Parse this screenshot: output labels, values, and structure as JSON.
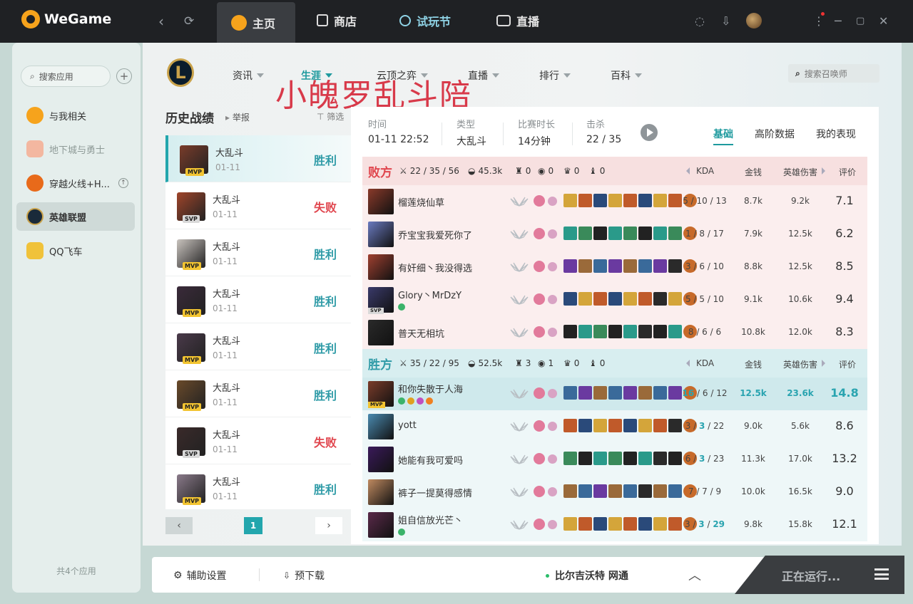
{
  "app": {
    "name": "WeGame"
  },
  "topnav": {
    "tabs": [
      {
        "label": "主页",
        "active": true
      },
      {
        "label": "商店"
      },
      {
        "label": "试玩节"
      },
      {
        "label": "直播"
      }
    ]
  },
  "sidebar": {
    "search_placeholder": "搜索应用",
    "items": [
      {
        "label": "与我相关",
        "color": "#f6a31c"
      },
      {
        "label": "地下城与勇士",
        "color": "#f3b7a0",
        "muted": true
      },
      {
        "label": "穿越火线+H...",
        "color": "#e86a1a"
      },
      {
        "label": "英雄联盟",
        "color": "#1a2a3a",
        "active": true
      },
      {
        "label": "QQ飞车",
        "color": "#f0c23a"
      }
    ],
    "footer": "共4个应用"
  },
  "game_menu": {
    "items": [
      "资讯",
      "生涯",
      "云顶之弈",
      "直播",
      "排行",
      "百科"
    ],
    "active": "生涯",
    "search_placeholder": "搜索召唤师",
    "watermark": "小魄罗乱斗陪"
  },
  "history": {
    "title": "历史战绩",
    "report": "举报",
    "filter": "筛选",
    "matches": [
      {
        "mode": "大乱斗",
        "date": "01-11",
        "result": "胜利",
        "badge": "MVP",
        "win": true,
        "color": "#7a3c2a"
      },
      {
        "mode": "大乱斗",
        "date": "01-11",
        "result": "失败",
        "badge": "SVP",
        "win": false,
        "color": "#a0452a"
      },
      {
        "mode": "大乱斗",
        "date": "01-11",
        "result": "胜利",
        "badge": "MVP",
        "win": true,
        "color": "#c9c3be"
      },
      {
        "mode": "大乱斗",
        "date": "01-11",
        "result": "胜利",
        "badge": "MVP",
        "win": true,
        "color": "#3a2a3a"
      },
      {
        "mode": "大乱斗",
        "date": "01-11",
        "result": "胜利",
        "badge": "MVP",
        "win": true,
        "color": "#4a3a4a"
      },
      {
        "mode": "大乱斗",
        "date": "01-11",
        "result": "胜利",
        "badge": "MVP",
        "win": true,
        "color": "#6a4a2a"
      },
      {
        "mode": "大乱斗",
        "date": "01-11",
        "result": "失败",
        "badge": "SVP",
        "win": false,
        "color": "#3a2a2a"
      },
      {
        "mode": "大乱斗",
        "date": "01-11",
        "result": "胜利",
        "badge": "MVP",
        "win": true,
        "color": "#8a7a8a"
      }
    ],
    "page": "1"
  },
  "match": {
    "labels": {
      "time": "时间",
      "type": "类型",
      "duration": "比赛时长",
      "kills": "击杀"
    },
    "time": "01-11 22:52",
    "type": "大乱斗",
    "duration": "14分钟",
    "kills": "22 / 35",
    "tabs": [
      "基础",
      "高阶数据",
      "我的表现"
    ],
    "columns": {
      "kda": "KDA",
      "gold": "金钱",
      "damage": "英雄伤害",
      "score": "评价"
    }
  },
  "teams": [
    {
      "name": "败方",
      "win": false,
      "kda": "22 / 35 / 56",
      "gold": "45.3k",
      "towers": "0",
      "inhib": "0",
      "baron": "0",
      "dragon": "0",
      "players": [
        {
          "name": "榴莲烧仙草",
          "kda": [
            "5",
            "10",
            "13"
          ],
          "gold": "8.7k",
          "damage": "9.2k",
          "score": "7.1",
          "color": "#8a3a2a",
          "badge": ""
        },
        {
          "name": "乔宝宝我爱死你了",
          "kda": [
            "1",
            "8",
            "17"
          ],
          "gold": "7.9k",
          "damage": "12.5k",
          "score": "6.2",
          "color": "#6a7ac0",
          "badge": ""
        },
        {
          "name": "有奸细丶我没得选",
          "kda": [
            "3",
            "6",
            "10"
          ],
          "gold": "8.8k",
          "damage": "12.5k",
          "score": "8.5",
          "color": "#a04030",
          "badge": ""
        },
        {
          "name": "Glory丶MrDzY",
          "kda": [
            "5",
            "5",
            "10"
          ],
          "gold": "9.1k",
          "damage": "10.6k",
          "score": "9.4",
          "color": "#3a3a6a",
          "badge": "SVP"
        },
        {
          "name": "普天无相坑",
          "kda": [
            "8",
            "6",
            "6"
          ],
          "gold": "10.8k",
          "damage": "12.0k",
          "score": "8.3",
          "color": "#2a2a2a",
          "badge": ""
        }
      ]
    },
    {
      "name": "胜方",
      "win": true,
      "kda": "35 / 22 / 95",
      "gold": "52.5k",
      "towers": "3",
      "inhib": "1",
      "baron": "0",
      "dragon": "0",
      "players": [
        {
          "name": "和你失散于人海",
          "kda": [
            "16",
            "6",
            "12"
          ],
          "gold": "12.5k",
          "damage": "23.6k",
          "score": "14.8",
          "color": "#7a3c2a",
          "badge": "MVP",
          "highlight": true
        },
        {
          "name": "yott",
          "kda": [
            "3",
            "3",
            "22"
          ],
          "gold": "9.0k",
          "damage": "5.6k",
          "score": "8.6",
          "color": "#4a8ab0",
          "badge": ""
        },
        {
          "name": "她能有我可爱吗",
          "kda": [
            "6",
            "3",
            "23"
          ],
          "gold": "11.3k",
          "damage": "17.0k",
          "score": "13.2",
          "color": "#3a1a5a",
          "badge": ""
        },
        {
          "name": "裤子一提莫得感情",
          "kda": [
            "7",
            "7",
            "9"
          ],
          "gold": "10.0k",
          "damage": "16.5k",
          "score": "9.0",
          "color": "#c08a60",
          "badge": ""
        },
        {
          "name": "姐自信放光芒丶",
          "kda": [
            "3",
            "3",
            "29"
          ],
          "gold": "9.8k",
          "damage": "15.8k",
          "score": "12.1",
          "color": "#5a2a4a",
          "badge": ""
        }
      ]
    }
  ],
  "bottombar": {
    "assist": "辅助设置",
    "predownload": "预下载",
    "server": "比尔吉沃特 网通",
    "running": "正在运行..."
  }
}
